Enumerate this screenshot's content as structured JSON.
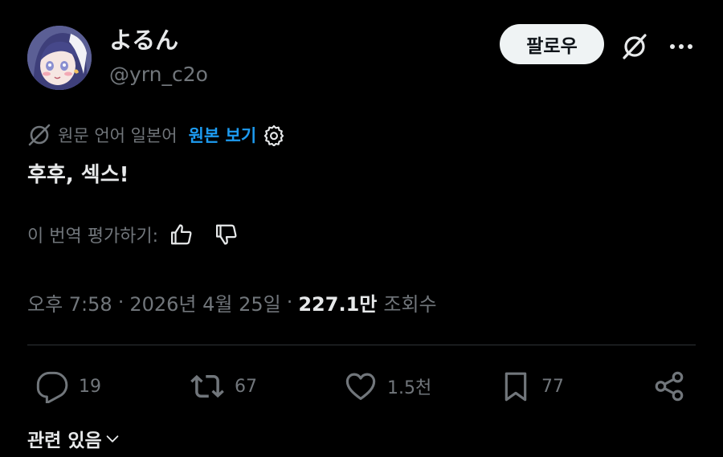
{
  "author": {
    "display_name": "よるん",
    "handle": "@yrn_c2o"
  },
  "header": {
    "follow_label": "팔로우"
  },
  "translation": {
    "source_language_label": "원문 언어 일본어",
    "show_original_label": "원본 보기"
  },
  "tweet": {
    "text": "후후, 섹스!"
  },
  "rating": {
    "prompt": "이 번역 평가하기:"
  },
  "meta": {
    "time": "오후 7:58",
    "separator": "·",
    "date": "2026년 4월 25일",
    "views_count": "227.1만",
    "views_label": "조회수"
  },
  "actions": {
    "replies": "19",
    "reposts": "67",
    "likes": "1.5천",
    "bookmarks": "77"
  },
  "related": {
    "label": "관련 있음"
  },
  "colors": {
    "background": "#000000",
    "text_primary": "#e7e9ea",
    "text_secondary": "#71767b",
    "link": "#1d9bf0",
    "follow_button_bg": "#eff3f4",
    "divider": "#2f3336"
  },
  "icons": {
    "grok": "grok-icon",
    "more": "more-icon",
    "translate": "translate-icon",
    "settings": "gear-icon",
    "thumbs_up": "thumbs-up-icon",
    "thumbs_down": "thumbs-down-icon",
    "reply": "reply-icon",
    "repost": "repost-icon",
    "like": "heart-icon",
    "bookmark": "bookmark-icon",
    "share": "share-icon",
    "chevron": "chevron-down-icon"
  }
}
